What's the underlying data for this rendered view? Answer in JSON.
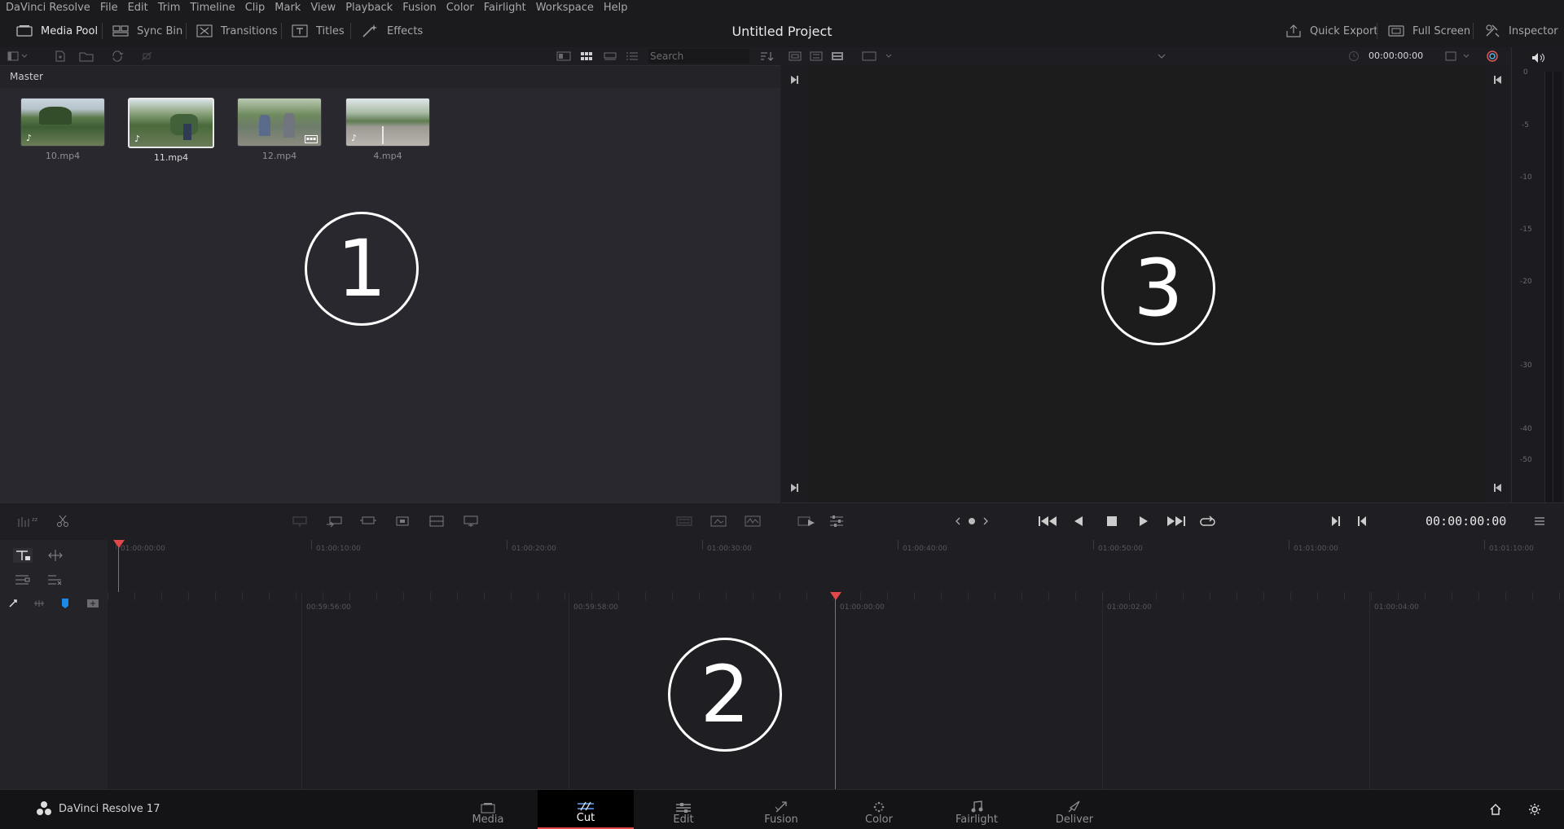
{
  "menu": {
    "app_name": "DaVinci Resolve",
    "items": [
      "File",
      "Edit",
      "Trim",
      "Timeline",
      "Clip",
      "Mark",
      "View",
      "Playback",
      "Fusion",
      "Color",
      "Fairlight",
      "Workspace",
      "Help"
    ]
  },
  "toolbar": {
    "media_pool": "Media Pool",
    "sync_bin": "Sync Bin",
    "transitions": "Transitions",
    "titles": "Titles",
    "effects": "Effects",
    "project_title": "Untitled Project",
    "quick_export": "Quick Export",
    "full_screen": "Full Screen",
    "inspector": "Inspector"
  },
  "media_pool": {
    "search_placeholder": "Search",
    "bin_name": "Master",
    "clips": [
      {
        "name": "10.mp4",
        "selected": false,
        "has_audio": true
      },
      {
        "name": "11.mp4",
        "selected": true,
        "has_audio": true
      },
      {
        "name": "12.mp4",
        "selected": false,
        "has_audio": false
      },
      {
        "name": "4.mp4",
        "selected": false,
        "has_audio": true
      }
    ]
  },
  "viewer": {
    "timecode_top": "00:00:00:00",
    "timecode_main": "00:00:00:00"
  },
  "audio_meter": {
    "scale": [
      "0",
      "-5",
      "-10",
      "-15",
      "-20",
      "-30",
      "-40",
      "-50"
    ]
  },
  "timeline": {
    "upper_ruler": [
      "01:00:00:00",
      "01:00:10:00",
      "01:00:20:00",
      "01:00:30:00",
      "01:00:40:00",
      "01:00:50:00",
      "01:01:00:00",
      "01:01:10:00"
    ],
    "lower_ruler": [
      "00:59:56:00",
      "00:59:58:00",
      "01:00:00:00",
      "01:00:02:00",
      "01:00:04:00"
    ]
  },
  "annotations": [
    "1",
    "2",
    "3"
  ],
  "bottom_nav": {
    "app_version": "DaVinci Resolve 17",
    "pages": [
      {
        "label": "Media",
        "active": false
      },
      {
        "label": "Cut",
        "active": true
      },
      {
        "label": "Edit",
        "active": false
      },
      {
        "label": "Fusion",
        "active": false
      },
      {
        "label": "Color",
        "active": false
      },
      {
        "label": "Fairlight",
        "active": false
      },
      {
        "label": "Deliver",
        "active": false
      }
    ]
  },
  "colors": {
    "playhead": "#e0484a",
    "accent_blue": "#1e88e5"
  }
}
